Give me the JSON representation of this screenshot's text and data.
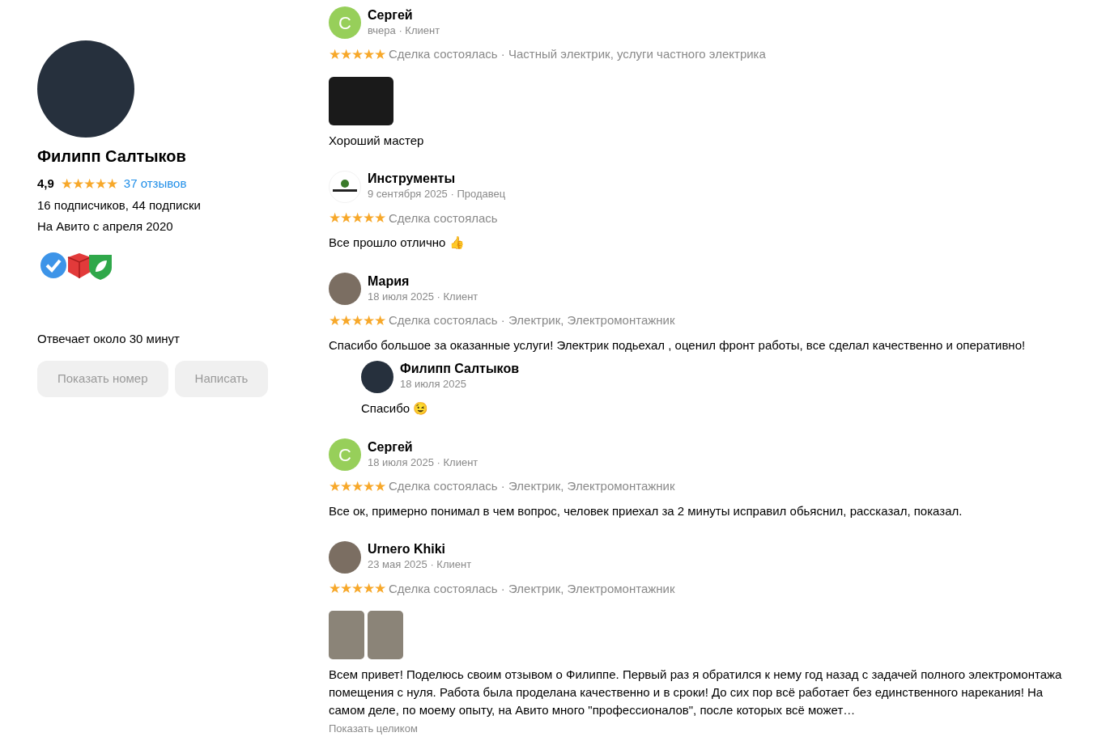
{
  "profile": {
    "name": "Филипп Салтыков",
    "rating": "4,9",
    "stars": 5,
    "reviews_link": "37 отзывов",
    "followers": "16 подписчиков, 44 подписки",
    "since": "На Авито с апреля 2020",
    "response": "Отвечает около 30 минут",
    "buttons": [
      "Показать номер",
      "Написать"
    ]
  },
  "reviews": [
    {
      "author": "Сергей",
      "avatar": {
        "kind": "letter",
        "letter": "С",
        "color": "#97cf5a"
      },
      "meta": "вчера · Клиент",
      "stars": 5,
      "deal": "Сделка состоялась · Частный электрик, услуги частного электрика",
      "photos": [
        {
          "kind": "wide"
        }
      ],
      "text": "Хороший мастер"
    },
    {
      "author": "Инструменты",
      "avatar": {
        "kind": "logo"
      },
      "meta": "9 сентября 2025 · Продавец",
      "stars": 5,
      "deal": "Сделка состоялась",
      "text": "Все прошло отлично 👍"
    },
    {
      "author": "Мария",
      "avatar": {
        "kind": "photo"
      },
      "meta": "18 июля 2025 · Клиент",
      "stars": 5,
      "deal": "Сделка состоялась · Электрик, Электромонтажник",
      "text": "Спасибо большое за оказанные услуги! Электрик подьехал , оценил фронт работы, все сделал качественно и оперативно!",
      "reply": {
        "author": "Филипп Салтыков",
        "meta": "18 июля 2025",
        "text": "Спасибо 😉"
      }
    },
    {
      "author": "Сергей",
      "avatar": {
        "kind": "letter",
        "letter": "С",
        "color": "#97cf5a"
      },
      "meta": "18 июля 2025 · Клиент",
      "stars": 5,
      "deal": "Сделка состоялась · Электрик, Электромонтажник",
      "text": "Все ок, примерно понимал в чем вопрос, человек приехал за 2 минуты исправил обьяснил, рассказал, показал."
    },
    {
      "author": "Urnero Khiki",
      "avatar": {
        "kind": "photo"
      },
      "meta": "23 мая 2025 · Клиент",
      "stars": 5,
      "deal": "Сделка состоялась · Электрик, Электромонтажник",
      "photos": [
        {
          "kind": "narrow"
        },
        {
          "kind": "narrow"
        }
      ],
      "text": "Всем привет! Поделюсь своим отзывом о Филиппе. Первый раз я обратился к нему год назад с задачей полного электромонтажа помещения с нуля. Работа была проделана качественно и в сроки! До сих пор всё работает без единственного нарекания! На самом деле, по моему опыту, на Авито много \"профессионалов\", после которых всё может…",
      "more": "Показать целиком"
    }
  ]
}
